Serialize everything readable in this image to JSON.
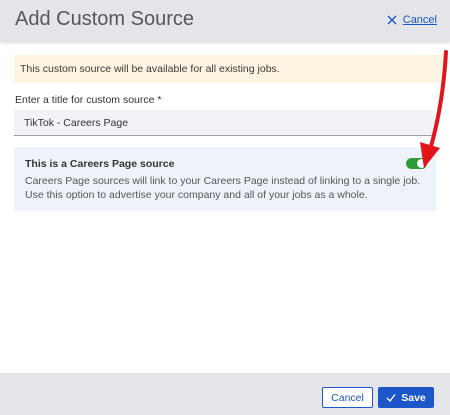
{
  "header": {
    "title": "Add Custom Source",
    "cancel_label": "Cancel"
  },
  "notice": {
    "text": "This custom source will be available for all existing jobs."
  },
  "form": {
    "title_label": "Enter a title for custom source *",
    "title_value": "TikTok - Careers Page"
  },
  "careers_page": {
    "heading": "This is a Careers Page source",
    "description": "Careers Page sources will link to your Careers Page instead of linking to a single job. Use this option to advertise your company and all of your jobs as a whole.",
    "toggle_on": true
  },
  "footer": {
    "cancel_label": "Cancel",
    "save_label": "Save"
  },
  "colors": {
    "accent": "#1c56c8",
    "toggle_on": "#2e9c3a",
    "annotation_arrow": "#e0161b",
    "notice_bg": "#fdf4e2",
    "header_bg": "#e4e5e8"
  },
  "icons": {
    "close": "close-icon",
    "check": "check-icon"
  }
}
